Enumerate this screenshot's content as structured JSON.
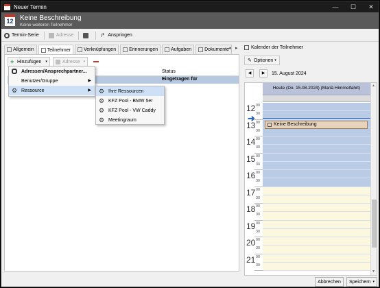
{
  "window": {
    "title": "Neuer Termin"
  },
  "header": {
    "title": "Keine Beschreibung",
    "subtitle": "Keine weiteren Teilnehmer",
    "cal_icon_number": "12"
  },
  "toolbar": {
    "serie": "Termin-Serie",
    "adresse": "Adresse",
    "anspringen": "Anspringen"
  },
  "tabs": [
    {
      "label": "Allgemein"
    },
    {
      "label": "Teilnehmer"
    },
    {
      "label": "Verknüpfungen"
    },
    {
      "label": "Erinnerungen"
    },
    {
      "label": "Aufgaben"
    },
    {
      "label": "Dokumente"
    }
  ],
  "left": {
    "add_label": "Hinzufügen",
    "adresse_label": "Adresse",
    "status_header": "Status",
    "row1_status": "Eingetragen für"
  },
  "menu1": [
    {
      "label": "Adressen/Ansprechpartner..."
    },
    {
      "label": "Benutzer/Gruppe"
    },
    {
      "label": "Ressource"
    }
  ],
  "menu2": [
    {
      "label": "Ihre Ressourcen"
    },
    {
      "label": "KFZ Pool - BMW 5er"
    },
    {
      "label": "KFZ Pool - VW Caddy"
    },
    {
      "label": "Meetingraum"
    }
  ],
  "right": {
    "title": "Kalender der Teilnehmer",
    "options": "Optionen",
    "date": "15. August 2024",
    "day_header": "Heute (Do. 15.08.2024) (Mariä Himmelfahrt)",
    "appointment": "Keine Beschreibung"
  },
  "hours": [
    {
      "h": "12",
      "m": "00",
      "h30": "30"
    },
    {
      "h": "13",
      "m": "00",
      "h30": "30"
    },
    {
      "h": "14",
      "m": "00",
      "h30": "30"
    },
    {
      "h": "15",
      "m": "00",
      "h30": "30"
    },
    {
      "h": "16",
      "m": "00",
      "h30": "30"
    },
    {
      "h": "17",
      "m": "00",
      "h30": "30"
    },
    {
      "h": "18",
      "m": "00",
      "h30": "30"
    },
    {
      "h": "19",
      "m": "00",
      "h30": "30"
    },
    {
      "h": "20",
      "m": "00",
      "h30": "30"
    },
    {
      "h": "21",
      "m": "00",
      "h30": "30"
    }
  ],
  "buttons": {
    "abbrechen": "Abbrechen",
    "speichern": "Speichern"
  },
  "colors": {
    "workhours": "#b9cbe5",
    "offhours": "#fbf8df",
    "dayheader": "#b9c2d8",
    "appointment": "#e8d3bd",
    "accent": "#2a66b5"
  }
}
